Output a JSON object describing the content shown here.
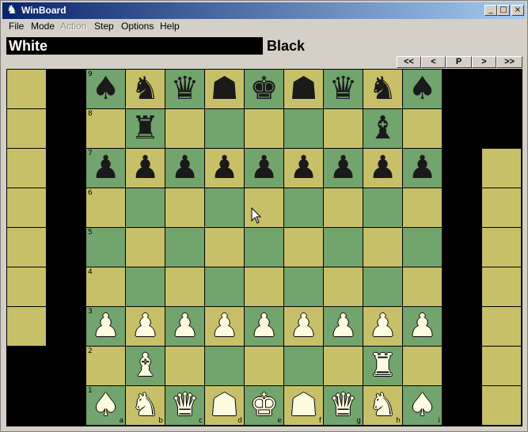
{
  "window": {
    "title": "WinBoard",
    "app_icon": "knight-icon"
  },
  "title_buttons": [
    "minimize-icon",
    "maximize-icon",
    "close-icon"
  ],
  "menu": [
    "File",
    "Mode",
    "Action",
    "Step",
    "Options",
    "Help"
  ],
  "menu_disabled": [
    "Action"
  ],
  "clocks": {
    "white": "White",
    "black": "Black"
  },
  "nav_buttons": [
    "<<",
    "<",
    "P",
    ">",
    ">>"
  ],
  "board": {
    "ranks": [
      "9",
      "8",
      "7",
      "6",
      "5",
      "4",
      "3",
      "2",
      "1"
    ],
    "files": [
      "a",
      "b",
      "c",
      "d",
      "e",
      "f",
      "g",
      "h",
      "i"
    ],
    "rows": [
      [
        "black-lance",
        "black-knight",
        "black-silver",
        "black-gold",
        "black-king",
        "black-gold",
        "black-silver",
        "black-knight",
        "black-lance"
      ],
      [
        "",
        "black-rook",
        "",
        "",
        "",
        "",
        "",
        "black-bishop",
        ""
      ],
      [
        "black-pawn",
        "black-pawn",
        "black-pawn",
        "black-pawn",
        "black-pawn",
        "black-pawn",
        "black-pawn",
        "black-pawn",
        "black-pawn"
      ],
      [
        "",
        "",
        "",
        "",
        "",
        "",
        "",
        "",
        ""
      ],
      [
        "",
        "",
        "",
        "",
        "",
        "",
        "",
        "",
        ""
      ],
      [
        "",
        "",
        "",
        "",
        "",
        "",
        "",
        "",
        ""
      ],
      [
        "white-pawn",
        "white-pawn",
        "white-pawn",
        "white-pawn",
        "white-pawn",
        "white-pawn",
        "white-pawn",
        "white-pawn",
        "white-pawn"
      ],
      [
        "",
        "white-bishop",
        "",
        "",
        "",
        "",
        "",
        "white-rook",
        ""
      ],
      [
        "white-lance",
        "white-knight",
        "white-silver",
        "white-gold",
        "white-king",
        "white-gold",
        "white-silver",
        "white-knight",
        "white-lance"
      ]
    ]
  },
  "glyphs": {
    "pawn": "♟",
    "knight": "♞",
    "rook": "♜",
    "bishop": "♝",
    "king": "♚",
    "silver": "♛",
    "gold": "☗",
    "lance": "♠"
  }
}
